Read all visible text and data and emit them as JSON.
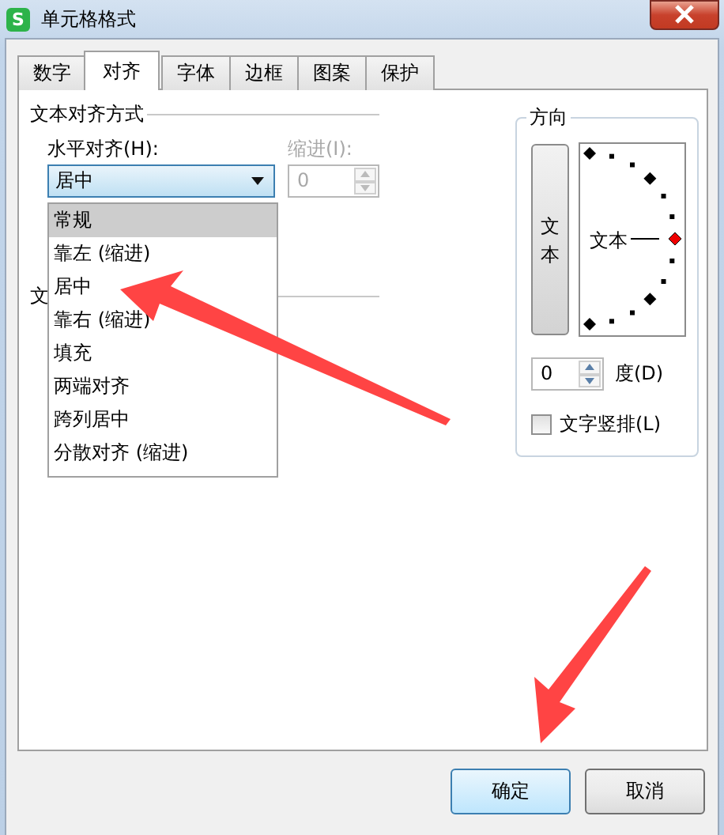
{
  "window": {
    "icon_letter": "S",
    "title": "单元格格式"
  },
  "tabs": [
    {
      "label": "数字",
      "selected": false
    },
    {
      "label": "对齐",
      "selected": true
    },
    {
      "label": "字体",
      "selected": false
    },
    {
      "label": "边框",
      "selected": false
    },
    {
      "label": "图案",
      "selected": false
    },
    {
      "label": "保护",
      "selected": false
    }
  ],
  "text_alignment": {
    "title": "文本对齐方式",
    "horizontal": {
      "label": "水平对齐(H):",
      "value": "居中",
      "expanded": true,
      "options": [
        {
          "label": "常规",
          "highlighted": true
        },
        {
          "label": "靠左 (缩进)",
          "highlighted": false
        },
        {
          "label": "居中",
          "highlighted": false
        },
        {
          "label": "靠右 (缩进)",
          "highlighted": false
        },
        {
          "label": "填充",
          "highlighted": false
        },
        {
          "label": "两端对齐",
          "highlighted": false
        },
        {
          "label": "跨列居中",
          "highlighted": false
        },
        {
          "label": "分散对齐 (缩进)",
          "highlighted": false
        }
      ]
    },
    "indent": {
      "label": "缩进(I):",
      "value": "0",
      "disabled": true
    }
  },
  "second_group": {
    "title": "文"
  },
  "orientation": {
    "title": "方向",
    "vertical_text": "文本",
    "dial_text": "文本",
    "degrees": {
      "value": "0",
      "label": "度(D)"
    },
    "vertical_checkbox": {
      "label": "文字竖排(L)",
      "checked": false
    }
  },
  "buttons": [
    {
      "label": "确定",
      "default": true
    },
    {
      "label": "取消",
      "default": false
    }
  ]
}
